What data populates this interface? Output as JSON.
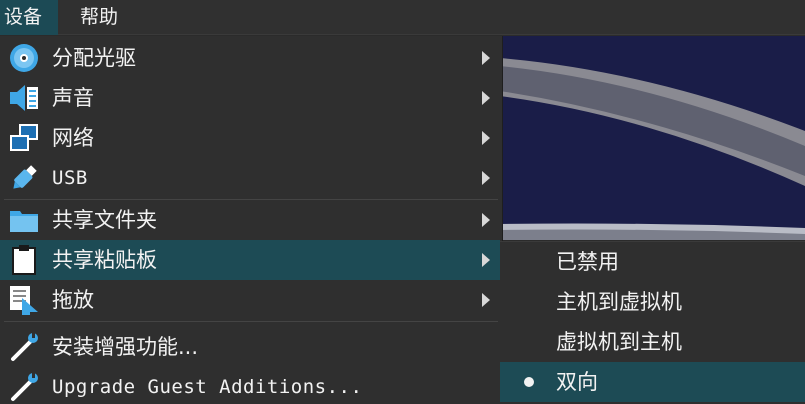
{
  "menubar": {
    "devices": "设备",
    "help": "帮助"
  },
  "devices_menu": {
    "items": [
      {
        "label": "分配光驱",
        "icon": "optical-disc-icon",
        "submenu": true
      },
      {
        "label": "声音",
        "icon": "audio-icon",
        "submenu": true
      },
      {
        "label": "网络",
        "icon": "network-icon",
        "submenu": true
      },
      {
        "label": "USB",
        "icon": "usb-icon",
        "submenu": true
      },
      {
        "label": "共享文件夹",
        "icon": "shared-folder-icon",
        "submenu": true
      },
      {
        "label": "共享粘贴板",
        "icon": "clipboard-icon",
        "submenu": true,
        "active": true
      },
      {
        "label": "拖放",
        "icon": "drag-drop-icon",
        "submenu": true
      },
      {
        "label": "安装增强功能...",
        "icon": "install-tool-icon",
        "submenu": false
      },
      {
        "label": "Upgrade Guest Additions...",
        "icon": "upgrade-tool-icon",
        "submenu": false
      }
    ]
  },
  "clipboard_submenu": {
    "items": [
      {
        "label": "已禁用",
        "selected": false
      },
      {
        "label": "主机到虚拟机",
        "selected": false
      },
      {
        "label": "虚拟机到主机",
        "selected": false
      },
      {
        "label": "双向",
        "selected": true
      }
    ]
  },
  "colors": {
    "highlight": "#1d4b55",
    "menu_bg": "#2f2f2f",
    "icon_blue": "#3fa7e6"
  }
}
